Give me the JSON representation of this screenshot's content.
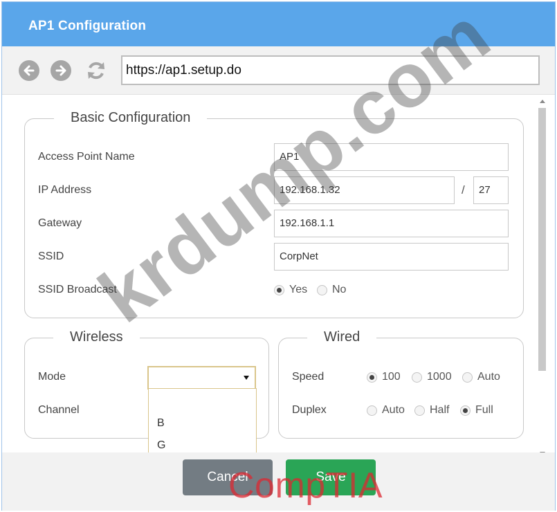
{
  "window": {
    "title": "AP1 Configuration"
  },
  "browser": {
    "back_icon": "back-arrow-icon",
    "forward_icon": "forward-arrow-icon",
    "refresh_icon": "refresh-icon",
    "url": "https://ap1.setup.do"
  },
  "basic": {
    "legend": "Basic Configuration",
    "ap_name_label": "Access Point Name",
    "ap_name_value": "AP1",
    "ip_label": "IP Address",
    "ip_value": "192.168.1.32",
    "cidr_sep": "/",
    "cidr_value": "27",
    "gateway_label": "Gateway",
    "gateway_value": "192.168.1.1",
    "ssid_label": "SSID",
    "ssid_value": "CorpNet",
    "broadcast_label": "SSID Broadcast",
    "broadcast_options": [
      "Yes",
      "No"
    ],
    "broadcast_selected": "Yes"
  },
  "wireless": {
    "legend": "Wireless",
    "mode_label": "Mode",
    "mode_value": "",
    "mode_options": [
      "",
      "B",
      "G"
    ],
    "channel_label": "Channel"
  },
  "wired": {
    "legend": "Wired",
    "speed_label": "Speed",
    "speed_options": [
      "100",
      "1000",
      "Auto"
    ],
    "speed_selected": "100",
    "duplex_label": "Duplex",
    "duplex_options": [
      "Auto",
      "Half",
      "Full"
    ],
    "duplex_selected": "Full"
  },
  "footer": {
    "cancel_label": "Cancel",
    "save_label": "Save"
  },
  "watermarks": {
    "site": "krdump.com",
    "brand": "CompTIA"
  },
  "colors": {
    "titlebar": "#5aa6ea",
    "save": "#2aa556",
    "cancel": "#737c83",
    "dropdown_border": "#d9c58a"
  }
}
